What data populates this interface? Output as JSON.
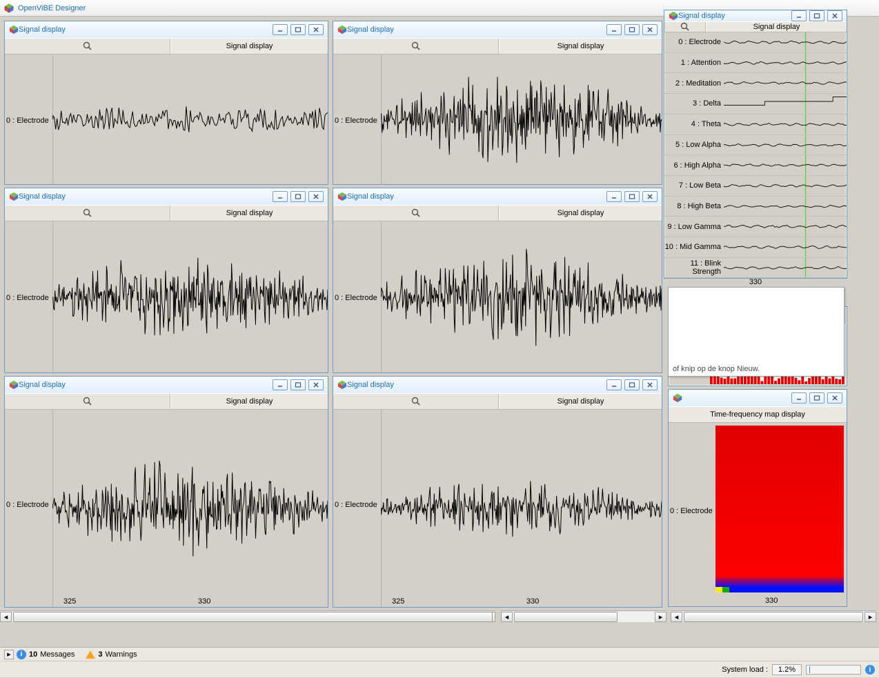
{
  "app_title": "OpenViBE Designer",
  "signal_panel_title": "Signal display",
  "toolbar_label": "Signal display",
  "tf_toolbar_label": "Time-frequency map display",
  "electrode_label": "0 : Electrode",
  "axis_ticks": [
    "325",
    "330"
  ],
  "channels_panel": {
    "axis_tick": "330",
    "items": [
      "0 : Electrode",
      "1 : Attention",
      "2 : Meditation",
      "3 : Delta",
      "4 : Theta",
      "5 : Low Alpha",
      "6 : High Alpha",
      "7 : Low Beta",
      "8 : High Beta",
      "9 : Low Gamma",
      "10 : Mid Gamma",
      "11 : Blink Strength"
    ]
  },
  "tooltip_text": "of knip op de knop Nieuw.",
  "tf_axis_tick": "330",
  "status": {
    "messages_count": "10",
    "messages_label": "Messages",
    "warnings_count": "3",
    "warnings_label": "Warnings",
    "sys_label": "System load :",
    "sys_value": "1.2%"
  }
}
